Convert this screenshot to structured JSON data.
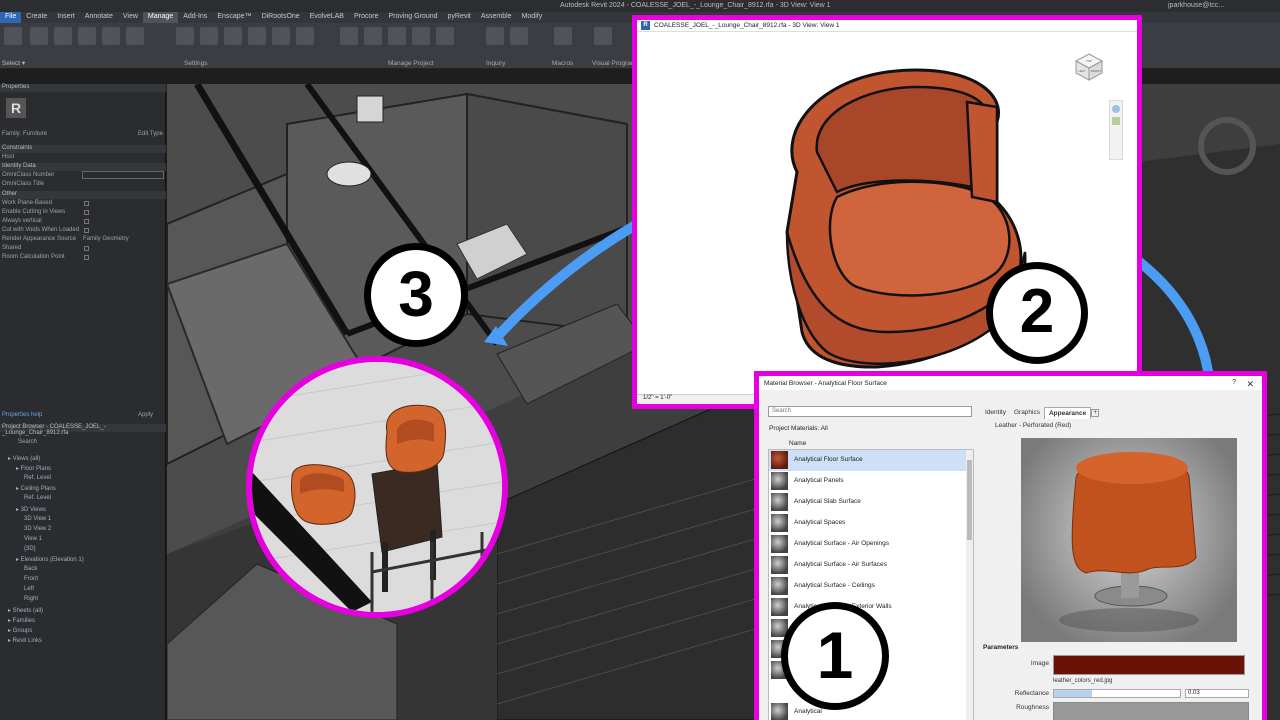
{
  "app": {
    "title": "Autodesk Revit 2024 - COALESSE_JOEL_-_Lounge_Chair_8912.rfa - 3D View: View 1",
    "user": "jparkhouse@tcc..."
  },
  "ribbon": {
    "tabs": [
      "File",
      "Create",
      "Insert",
      "Annotate",
      "View",
      "Manage",
      "Add-Ins",
      "Enscape™",
      "DiRootsOne",
      "EvolveLAB",
      "Procore",
      "Proving Ground",
      "pyRevit",
      "Assemble",
      "Modify"
    ],
    "active_tab": "Manage",
    "panels": [
      "Settings",
      "Manage Project",
      "Inquiry",
      "Macros",
      "Visual Programming"
    ],
    "select_label": "Select ▾"
  },
  "properties": {
    "header": "Properties",
    "type_selector": "Family: Furniture",
    "edit_type": "Edit Type",
    "groups": [
      {
        "name": "Constraints",
        "rows": [
          "Host"
        ]
      },
      {
        "name": "Identity Data",
        "rows": [
          "OmniClass Number",
          "OmniClass Title"
        ]
      },
      {
        "name": "Other",
        "rows": [
          "Work Plane-Based",
          "Enable Cutting in Views",
          "Always vertical",
          "Cut with Voids When Loaded",
          "Render Appearance Source",
          "Shared",
          "Room Calculation Point"
        ]
      }
    ],
    "render_source_value": "Family Geometry",
    "help_link": "Properties help",
    "apply": "Apply"
  },
  "project_browser": {
    "header": "Project Browser - COALESSE_JOEL_-_Lounge_Chair_8912.rfa",
    "search_placeholder": "Search",
    "tree": [
      {
        "label": "Views (all)",
        "level": 0
      },
      {
        "label": "Floor Plans",
        "level": 1
      },
      {
        "label": "Ref. Level",
        "level": 2
      },
      {
        "label": "Ceiling Plans",
        "level": 1
      },
      {
        "label": "Ref. Level",
        "level": 2
      },
      {
        "label": "3D Views",
        "level": 1
      },
      {
        "label": "3D View 1",
        "level": 2
      },
      {
        "label": "3D View 2",
        "level": 2
      },
      {
        "label": "View 1",
        "level": 2
      },
      {
        "label": "{3D}",
        "level": 2
      },
      {
        "label": "Elevations (Elevation 1)",
        "level": 1
      },
      {
        "label": "Back",
        "level": 2
      },
      {
        "label": "Front",
        "level": 2
      },
      {
        "label": "Left",
        "level": 2
      },
      {
        "label": "Right",
        "level": 2
      },
      {
        "label": "Sheets (all)",
        "level": 0
      },
      {
        "label": "Families",
        "level": 0
      },
      {
        "label": "Groups",
        "level": 0
      },
      {
        "label": "Revit Links",
        "level": 0
      }
    ]
  },
  "family_window": {
    "title": "COALESSE_JOEL_-_Lounge_Chair_8912.rfa - 3D View: View 1",
    "scale": "1/2\" = 1'-0\"",
    "cube_labels": [
      "TOP",
      "LEFT",
      "FRONT"
    ]
  },
  "material_browser": {
    "title": "Material Browser - Analytical Floor Surface",
    "help": "?",
    "close": "✕",
    "search_placeholder": "Search",
    "project_materials_label": "Project Materials: All",
    "column_name": "Name",
    "materials": [
      "Analytical Floor Surface",
      "Analytical Panels",
      "Analytical Slab Surface",
      "Analytical Spaces",
      "Analytical Surface - Air Openings",
      "Analytical Surface - Air Surfaces",
      "Analytical Surface - Ceilings",
      "Analytical Surface - Exterior Walls",
      "",
      "",
      "",
      "Analytical"
    ],
    "tabs": [
      "Identity",
      "Graphics",
      "Appearance"
    ],
    "active_tab": "Appearance",
    "asset_name": "Leather - Perforated (Red)",
    "parameters_header": "Parameters",
    "params": {
      "image_label": "Image",
      "image_file": "leather_colors_red.jpg",
      "reflectance_label": "Reflectance",
      "reflectance_value": "0.03",
      "roughness_label": "Roughness"
    },
    "colors": {
      "leather": "#6b1208",
      "selected_row": "#cde0f7"
    }
  },
  "callouts": {
    "one": "1",
    "two": "2",
    "three": "3",
    "accent": "#e600e0",
    "arrow": "#4a9cf5"
  }
}
